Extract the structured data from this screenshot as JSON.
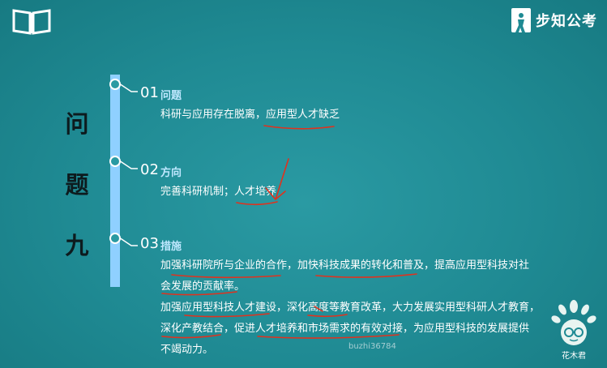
{
  "brand": {
    "name": "步知公考"
  },
  "title_chars": [
    "问",
    "题",
    "九"
  ],
  "sections": [
    {
      "num": "01",
      "heading": "问题",
      "lines": [
        "科研与应用存在脱离，应用型人才缺乏"
      ]
    },
    {
      "num": "02",
      "heading": "方向",
      "lines": [
        "完善科研机制；人才培养"
      ]
    },
    {
      "num": "03",
      "heading": "措施",
      "lines": [
        "加强科研院所与企业的合作，加快科技成果的转化和普及，提高应用型科技对社",
        "会发展的贡献率。",
        "加强应用型科技人才建设，深化高度等教育改革，大力发展实用型科研人才教育，",
        "深化产教结合，促进人才培养和市场需求的有效对接，为应用型科技的发展提供",
        "不竭动力。"
      ]
    }
  ],
  "watermark": "buzhi36784",
  "mascot_label": "花木君",
  "colors": {
    "background": "#1f8a93",
    "timeline": "#8fd0ff",
    "heading": "#bfe8ff",
    "annotation": "#e0321e"
  },
  "icons": [
    "open-book-icon",
    "brand-logo-icon",
    "mascot-icon"
  ]
}
